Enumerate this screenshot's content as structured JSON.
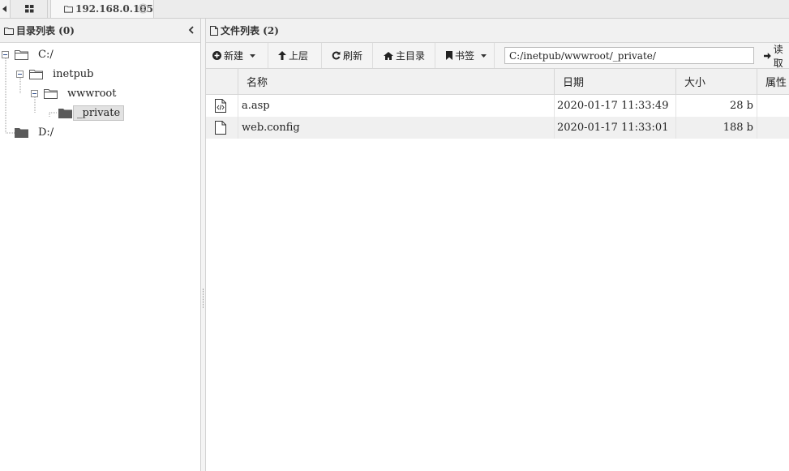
{
  "tabbar": {
    "host_tab_label": "192.168.0.105"
  },
  "dir_panel": {
    "title": "目录列表 (0)",
    "tree": {
      "c_drive": "C:/",
      "inetpub": "inetpub",
      "wwwroot": "wwwroot",
      "private": "_private",
      "d_drive": "D:/"
    }
  },
  "file_panel": {
    "title": "文件列表 (2)",
    "toolbar": {
      "new_label": "新建",
      "up_label": "上层",
      "refresh_label": "刷新",
      "home_label": "主目录",
      "bookmark_label": "书签",
      "path_value": "C:/inetpub/wwwroot/_private/",
      "read_label": "读取"
    },
    "columns": {
      "name": "名称",
      "date": "日期",
      "size": "大小",
      "attr": "属性"
    },
    "files": [
      {
        "name": "a.asp",
        "date": "2020-01-17 11:33:49",
        "size": "28 b",
        "icon": "code-file-icon"
      },
      {
        "name": "web.config",
        "date": "2020-01-17 11:33:01",
        "size": "188 b",
        "icon": "file-icon"
      }
    ]
  },
  "colors": {
    "panel_header_bg": "#f1f1f1",
    "row_alt_bg": "#f0f0f0",
    "selected_bg": "#e2e2e2",
    "folder_dark": "#5a5a5a"
  }
}
